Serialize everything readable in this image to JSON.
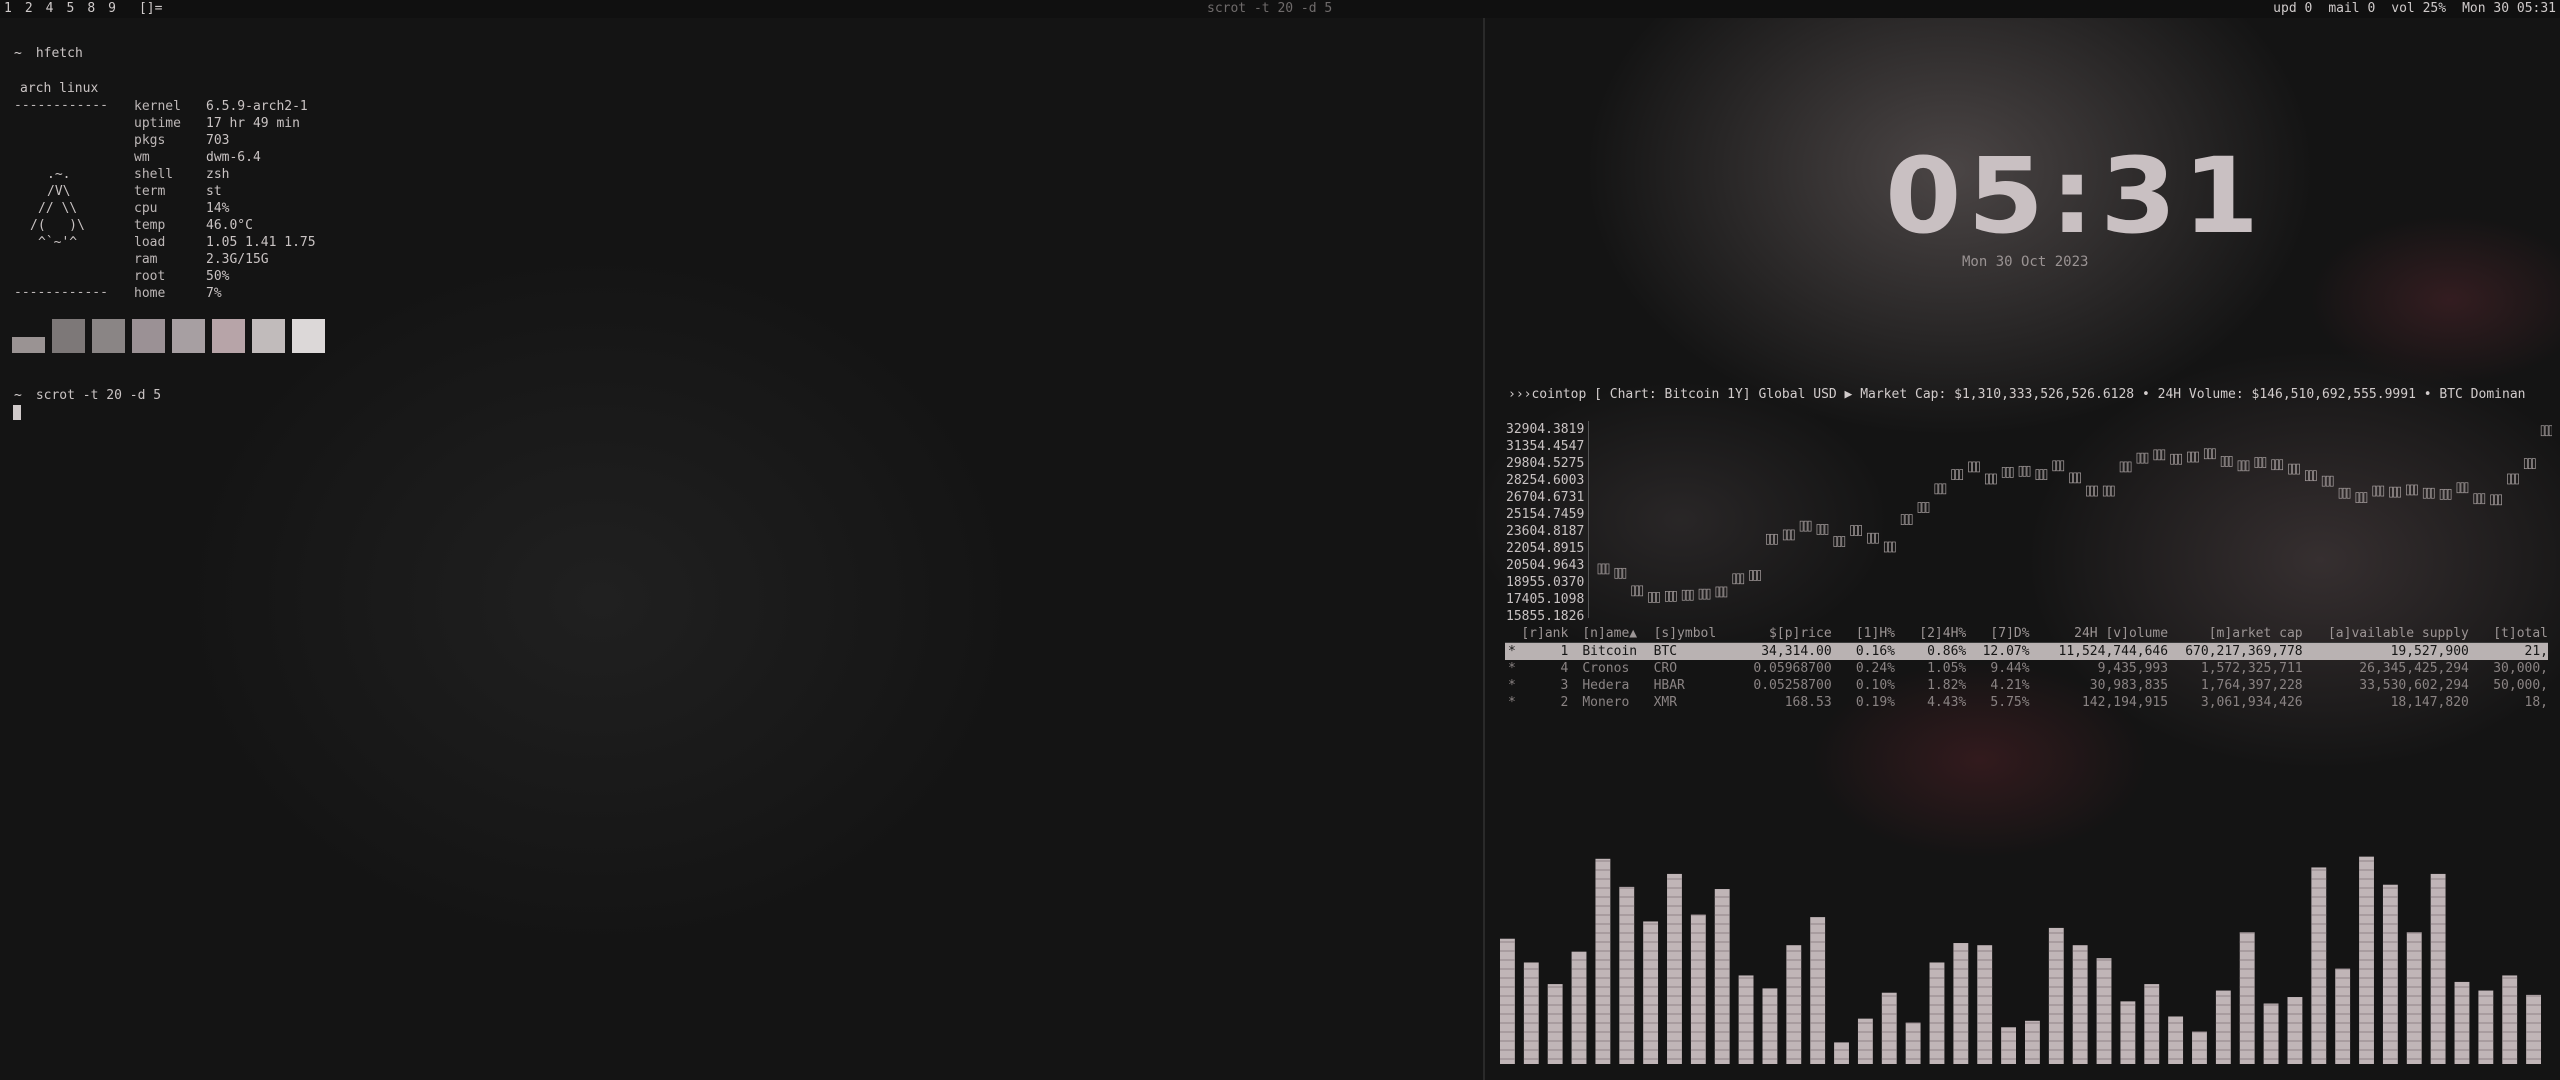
{
  "bar": {
    "tags": [
      "1",
      "2",
      "4",
      "5",
      "8",
      "9"
    ],
    "layout": "[]=",
    "window_title": "scrot -t 20 -d 5",
    "status": [
      "upd 0",
      "mail 0",
      "vol 25%",
      "Mon 30 05:31"
    ]
  },
  "terminal": {
    "prompt_symbol": "~",
    "cmd1": "hfetch",
    "host": "arch linux",
    "separator": "------------",
    "logo_lines": [
      ".~.",
      "/V\\",
      "// \\\\",
      "/(   )\\",
      "^`~'^"
    ],
    "info": [
      {
        "key": "kernel",
        "value": "6.5.9-arch2-1"
      },
      {
        "key": "uptime",
        "value": "17 hr 49 min"
      },
      {
        "key": "pkgs",
        "value": "703"
      },
      {
        "key": "wm",
        "value": "dwm-6.4"
      },
      {
        "key": "shell",
        "value": "zsh"
      },
      {
        "key": "term",
        "value": "st"
      },
      {
        "key": "cpu",
        "value": "14%"
      },
      {
        "key": "temp",
        "value": "46.0°C"
      },
      {
        "key": "load",
        "value": "1.05 1.41 1.75"
      },
      {
        "key": "ram",
        "value": "2.3G/15G"
      },
      {
        "key": "root",
        "value": "50%"
      },
      {
        "key": "home",
        "value": "7%"
      }
    ],
    "swatch_colors": [
      "#9a9393",
      "#7d7878",
      "#8a8585",
      "#9b9195",
      "#a79fa2",
      "#b7a4a8",
      "#c1bbbb",
      "#dcd8d8"
    ],
    "cmd2": "scrot -t 20 -d 5"
  },
  "clock": {
    "time": "05:31",
    "date": "Mon 30 Oct 2023"
  },
  "cointop": {
    "header": "›››cointop [ Chart: Bitcoin 1Y] Global USD ▶ Market Cap: $1,310,333,526,526.6128 • 24H Volume: $146,510,692,555.9991 • BTC Dominan",
    "y_labels": [
      "32904.3819",
      "31354.4547",
      "29804.5275",
      "28254.6003",
      "26704.6731",
      "25154.7459",
      "23604.8187",
      "22054.8915",
      "20504.9643",
      "18955.0370",
      "17405.1098",
      "15855.1826"
    ],
    "columns": [
      "[r]ank",
      "[n]ame▲",
      "[s]ymbol",
      "$[p]rice",
      "[1]H%",
      "[2]4H%",
      "[7]D%",
      "24H [v]olume",
      "[m]arket cap",
      "[a]vailable supply",
      "[t]otal"
    ],
    "rows": [
      {
        "star": "*",
        "rank": "1",
        "name": "Bitcoin",
        "symbol": "BTC",
        "price": "34,314.00",
        "h1": "0.16%",
        "h24": "0.86%",
        "d7": "12.07%",
        "volume": "11,524,744,646",
        "mcap": "670,217,369,778",
        "supply": "19,527,900",
        "total": "21,"
      },
      {
        "star": "*",
        "rank": "4",
        "name": "Cronos",
        "symbol": "CRO",
        "price": "0.05968700",
        "h1": "0.24%",
        "h24": "1.05%",
        "d7": "9.44%",
        "volume": "9,435,993",
        "mcap": "1,572,325,711",
        "supply": "26,345,425,294",
        "total": "30,000,"
      },
      {
        "star": "*",
        "rank": "3",
        "name": "Hedera",
        "symbol": "HBAR",
        "price": "0.05258700",
        "h1": "0.10%",
        "h24": "1.82%",
        "d7": "4.21%",
        "volume": "30,983,835",
        "mcap": "1,764,397,228",
        "supply": "33,530,602,294",
        "total": "50,000,"
      },
      {
        "star": "*",
        "rank": "2",
        "name": "Monero",
        "symbol": "XMR",
        "price": "168.53",
        "h1": "0.19%",
        "h24": "4.43%",
        "d7": "5.75%",
        "volume": "142,194,915",
        "mcap": "3,061,934,426",
        "supply": "18,147,820",
        "total": "18,"
      }
    ],
    "chart_series": [
      19600,
      19200,
      17600,
      17000,
      17100,
      17200,
      17300,
      17500,
      18700,
      19000,
      22300,
      22700,
      23500,
      23200,
      22100,
      23100,
      22400,
      21600,
      24100,
      25200,
      26900,
      28200,
      28900,
      27800,
      28400,
      28500,
      28200,
      29000,
      27900,
      26700,
      26700,
      28900,
      29700,
      30000,
      29600,
      29800,
      30100,
      29400,
      29000,
      29300,
      29100,
      28700,
      28100,
      27600,
      26500,
      26100,
      26700,
      26600,
      26800,
      26500,
      26400,
      27000,
      26000,
      25900,
      27800,
      29200,
      32200
    ]
  },
  "visualizer": {
    "levels": [
      0.58,
      0.47,
      0.37,
      0.52,
      0.95,
      0.82,
      0.66,
      0.88,
      0.69,
      0.81,
      0.41,
      0.35,
      0.55,
      0.68,
      0.1,
      0.21,
      0.33,
      0.19,
      0.47,
      0.56,
      0.55,
      0.17,
      0.2,
      0.63,
      0.55,
      0.49,
      0.29,
      0.37,
      0.22,
      0.15,
      0.34,
      0.61,
      0.28,
      0.31,
      0.91,
      0.44,
      0.96,
      0.83,
      0.61,
      0.88,
      0.38,
      0.34,
      0.41,
      0.32
    ]
  }
}
